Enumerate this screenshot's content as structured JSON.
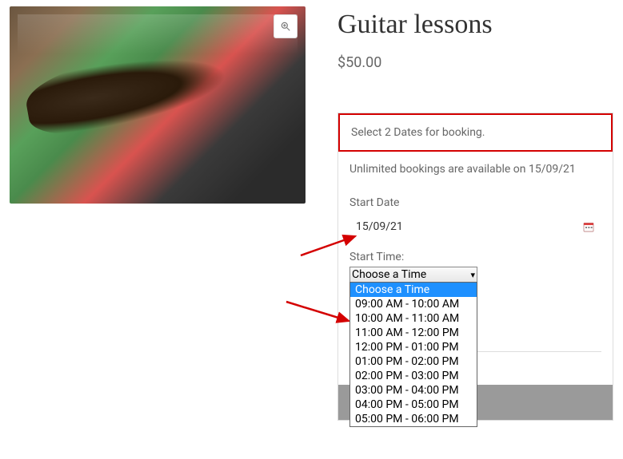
{
  "product": {
    "title": "Guitar lessons",
    "price": "$50.00"
  },
  "booking": {
    "select_dates_msg": "Select 2 Dates for booking.",
    "availability_msg": "Unlimited bookings are available on 15/09/21",
    "start_date_label": "Start Date",
    "start_date_value": "15/09/21",
    "start_time_label": "Start Time:",
    "time_selected": "Choose a Time",
    "time_options": [
      "Choose a Time",
      "09:00 AM - 10:00 AM",
      "10:00 AM - 11:00 AM",
      "11:00 AM - 12:00 PM",
      "12:00 PM - 01:00 PM",
      "01:00 PM - 02:00 PM",
      "02:00 PM - 03:00 PM",
      "03:00 PM - 04:00 PM",
      "04:00 PM - 05:00 PM",
      "05:00 PM - 06:00 PM"
    ]
  },
  "icons": {
    "zoom": "zoom-icon",
    "calendar": "calendar-icon"
  }
}
